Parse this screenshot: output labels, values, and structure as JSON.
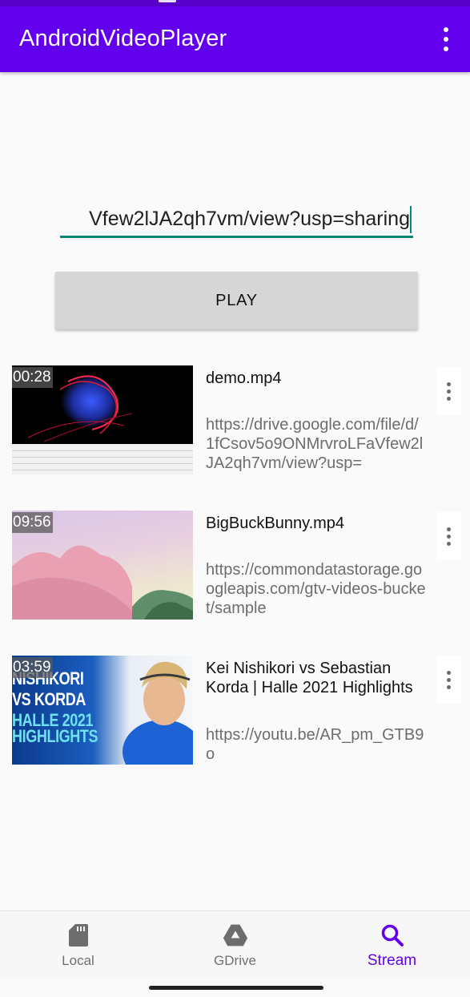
{
  "app_bar": {
    "title": "AndroidVideoPlayer",
    "overflow_icon": "more-vert-icon",
    "background": "#6200ee"
  },
  "url_input": {
    "value": "Vfew2lJA2qh7vm/view?usp=sharing",
    "accent": "#00897b"
  },
  "play_button": {
    "label": "PLAY"
  },
  "videos": [
    {
      "duration": "00:28",
      "title": "demo.mp4",
      "url": "https://drive.google.com/file/d/1fCsov5o9ONMrvroLFaVfew2lJA2qh7vm/view?usp="
    },
    {
      "duration": "09:56",
      "title": "BigBuckBunny.mp4",
      "url": "https://commondatastorage.googleapis.com/gtv-videos-bucket/sample"
    },
    {
      "duration": "03:59",
      "title": "Kei Nishikori vs Sebastian Korda | Halle 2021 Highlights",
      "url": "https://youtu.be/AR_pm_GTB9o",
      "thumbnail_text": [
        "NISHIKORI",
        "VS KORDA",
        "HALLE 2021",
        "HIGHLIGHTS"
      ]
    }
  ],
  "bottom_nav": {
    "items": [
      {
        "label": "Local",
        "icon": "sd-card-icon",
        "active": false
      },
      {
        "label": "GDrive",
        "icon": "google-drive-icon",
        "active": false
      },
      {
        "label": "Stream",
        "icon": "search-icon",
        "active": true
      }
    ],
    "active_color": "#6200ee"
  }
}
